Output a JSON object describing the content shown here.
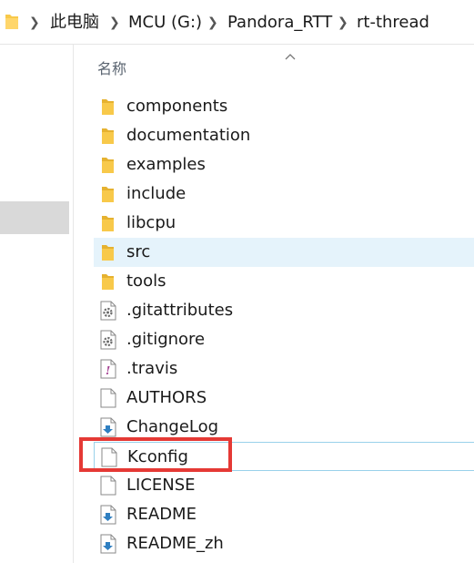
{
  "breadcrumb": [
    "此电脑",
    "MCU (G:)",
    "Pandora_RTT",
    "rt-thread"
  ],
  "column_header": "名称",
  "files": [
    {
      "name": "components",
      "type": "folder"
    },
    {
      "name": "documentation",
      "type": "folder"
    },
    {
      "name": "examples",
      "type": "folder"
    },
    {
      "name": "include",
      "type": "folder"
    },
    {
      "name": "libcpu",
      "type": "folder"
    },
    {
      "name": "src",
      "type": "folder"
    },
    {
      "name": "tools",
      "type": "folder"
    },
    {
      "name": ".gitattributes",
      "type": "config"
    },
    {
      "name": ".gitignore",
      "type": "config"
    },
    {
      "name": ".travis",
      "type": "yml"
    },
    {
      "name": "AUTHORS",
      "type": "file"
    },
    {
      "name": "ChangeLog",
      "type": "download"
    },
    {
      "name": "Kconfig",
      "type": "file"
    },
    {
      "name": "LICENSE",
      "type": "file"
    },
    {
      "name": "README",
      "type": "download"
    },
    {
      "name": "README_zh",
      "type": "download"
    }
  ],
  "colors": {
    "folder": "#f8c94a",
    "selected": "#e5f3fb",
    "highlight": "#e53935"
  }
}
